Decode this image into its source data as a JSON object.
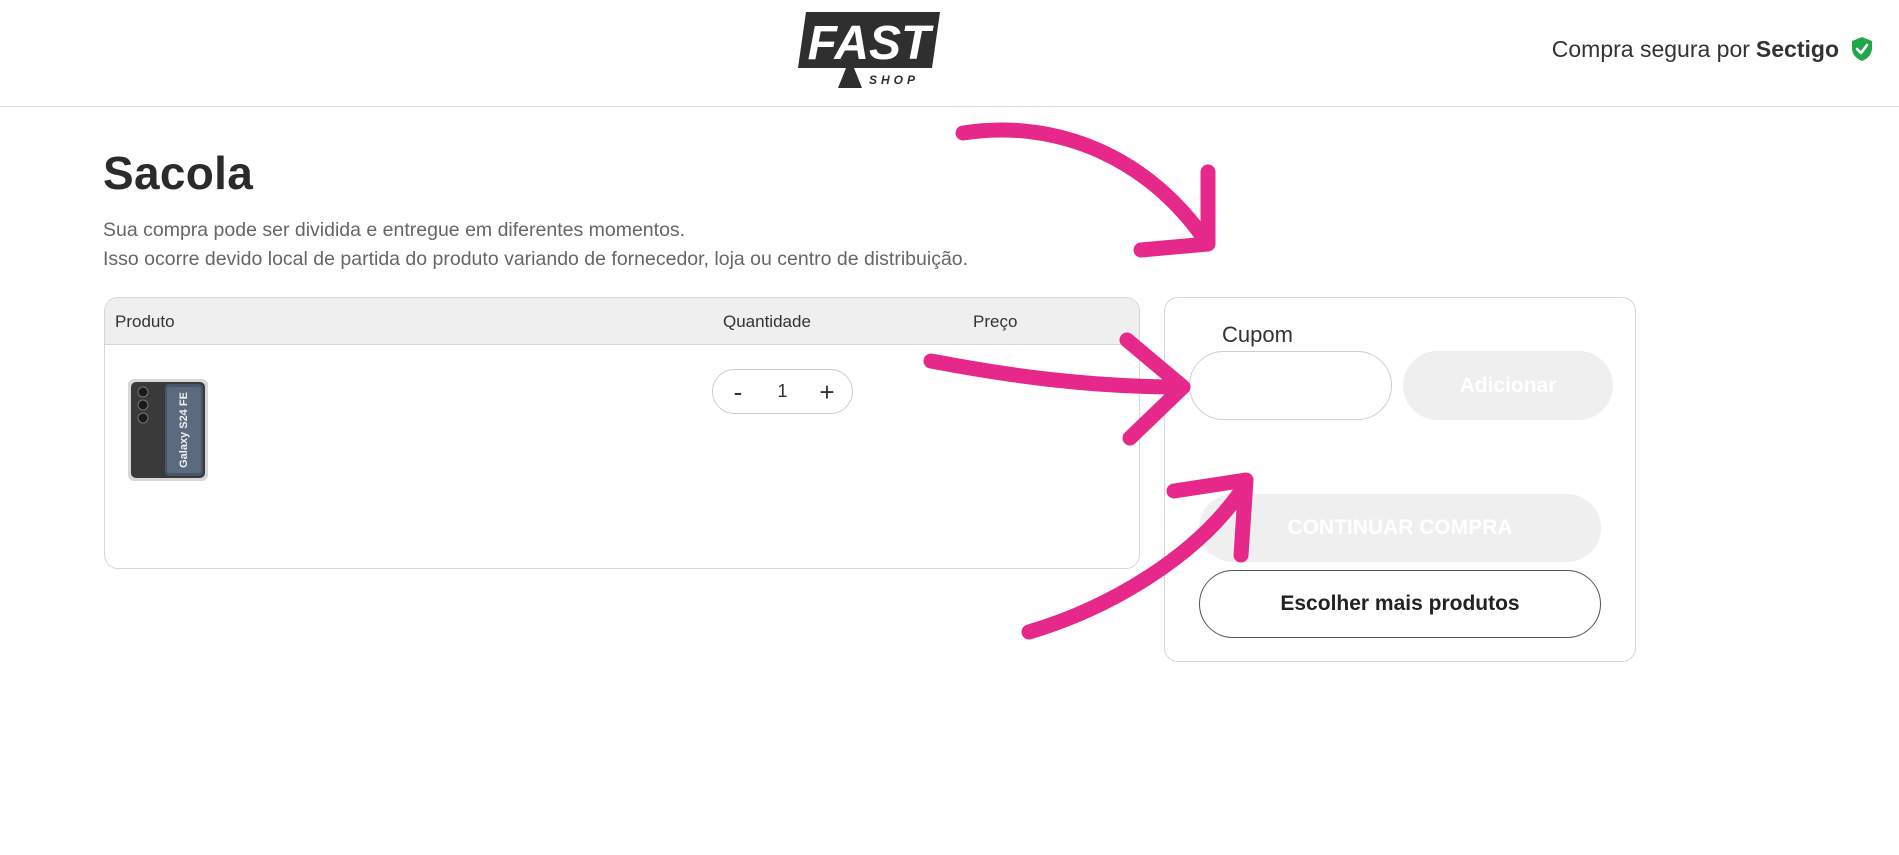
{
  "header": {
    "logo_text": "FAST",
    "logo_subtext": "SHOP",
    "secure_prefix": "Compra segura por",
    "secure_brand": "Sectigo"
  },
  "page": {
    "title": "Sacola",
    "notice_line1": "Sua compra pode ser dividida e entregue em diferentes momentos.",
    "notice_line2": "Isso ocorre devido local de partida do produto variando de fornecedor, loja ou centro de distribuição."
  },
  "cart": {
    "columns": [
      "Produto",
      "Quantidade",
      "Preço"
    ],
    "items": [
      {
        "image_label": "Galaxy S24 FE",
        "quantity": "1",
        "decrement_label": "-",
        "increment_label": "+"
      }
    ]
  },
  "summary": {
    "coupon_label": "Cupom",
    "coupon_value": "",
    "add_label": "Adicionar",
    "continue_label": "CONTINUAR COMPRA",
    "more_label": "Escolher mais produtos"
  },
  "colors": {
    "accent_arrow": "#e5288a",
    "shield": "#1fa74a",
    "disabled_button": "#efefef"
  },
  "icons": [
    "shield-check-icon",
    "minus-icon",
    "plus-icon",
    "arrow-annotation"
  ]
}
